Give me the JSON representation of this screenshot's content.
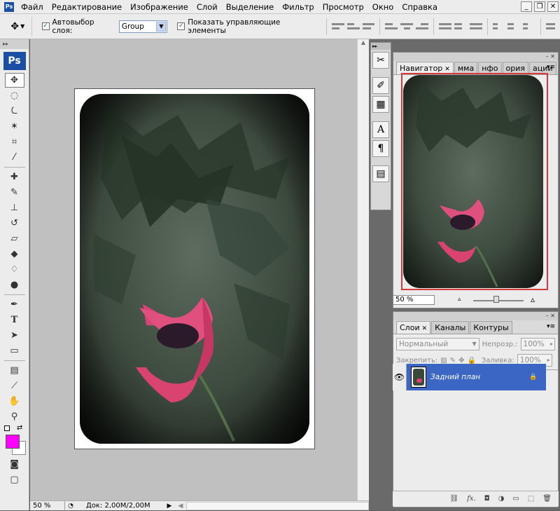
{
  "app": {
    "logo": "Ps"
  },
  "menubar": {
    "items": [
      "Файл",
      "Редактирование",
      "Изображение",
      "Слой",
      "Выделение",
      "Фильтр",
      "Просмотр",
      "Окно",
      "Справка"
    ],
    "window_buttons": [
      "_",
      "❐",
      "✕"
    ]
  },
  "options": {
    "auto_select_label": "Автовыбор слоя:",
    "auto_select_checked": true,
    "auto_select_value": "Group",
    "show_controls_label": "Показать управляющие элементы",
    "show_controls_checked": true
  },
  "status": {
    "zoom": "50 %",
    "doc_info": "Док: 2,00M/2,00M"
  },
  "navigator": {
    "tabs": [
      "Навигатор",
      "Гистограмма",
      "Инфо",
      "История",
      "Операции"
    ],
    "tabs_visible": [
      "Навигатор",
      "мма",
      "нфо",
      "ория",
      "ации"
    ],
    "zoom": "50 %"
  },
  "layers": {
    "tabs": [
      "Слои",
      "Каналы",
      "Контуры"
    ],
    "blend_mode": "Нормальный",
    "opacity_label": "Непрозр.:",
    "opacity_value": "100%",
    "lock_label": "Закрепить:",
    "fill_label": "Заливка:",
    "fill_value": "100%",
    "layer_name": "Задний план"
  },
  "colors": {
    "foreground": "#ff00ff",
    "background": "#ffffff",
    "selection": "#3b66c4",
    "navigator_frame": "#d63b3b"
  }
}
